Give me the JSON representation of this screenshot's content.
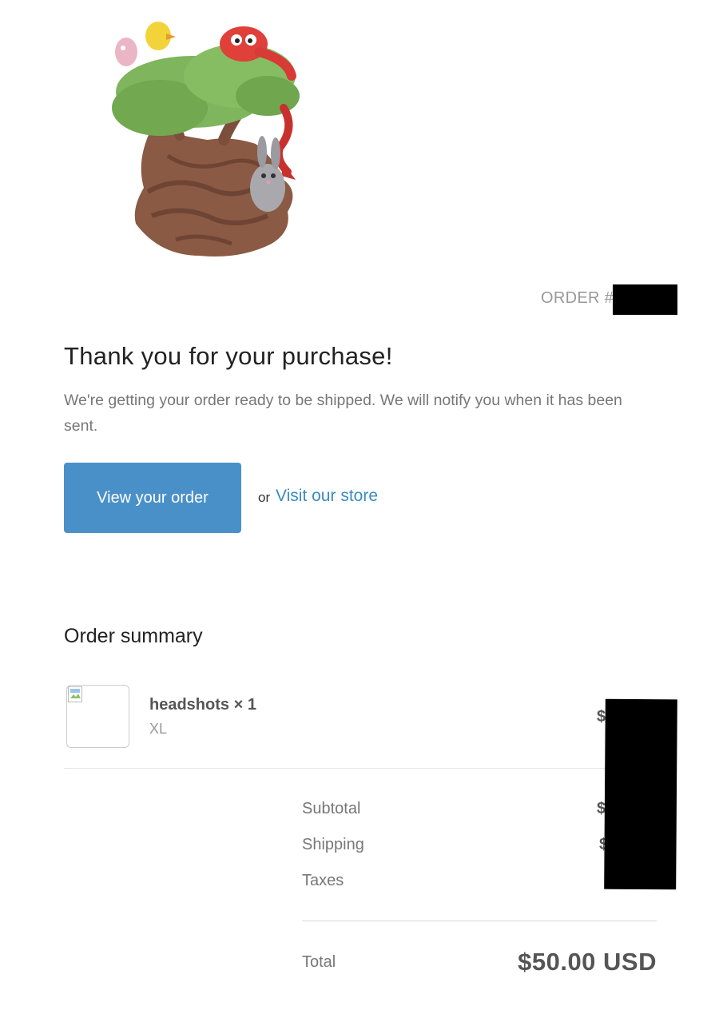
{
  "header": {
    "logo": "logo",
    "order_label": "ORDER #"
  },
  "main": {
    "title": "Thank you for your purchase!",
    "subtitle": "We're getting your order ready to be shipped. We will notify you when it has been sent.",
    "view_order_button": "View your order",
    "or_text": "or",
    "visit_store_link": "Visit our store"
  },
  "summary": {
    "title": "Order summary",
    "items": [
      {
        "name": "headshots × 1",
        "variant": "XL",
        "price_visible": "$"
      }
    ],
    "rows": [
      {
        "label": "Subtotal",
        "value_visible": "$"
      },
      {
        "label": "Shipping",
        "value_visible": "$"
      },
      {
        "label": "Taxes",
        "value_visible": ""
      }
    ],
    "total_label": "Total",
    "total_value": "$50.00 USD"
  },
  "colors": {
    "button": "#4a90c8",
    "link": "#3a8cc0",
    "redaction": "#000000"
  }
}
